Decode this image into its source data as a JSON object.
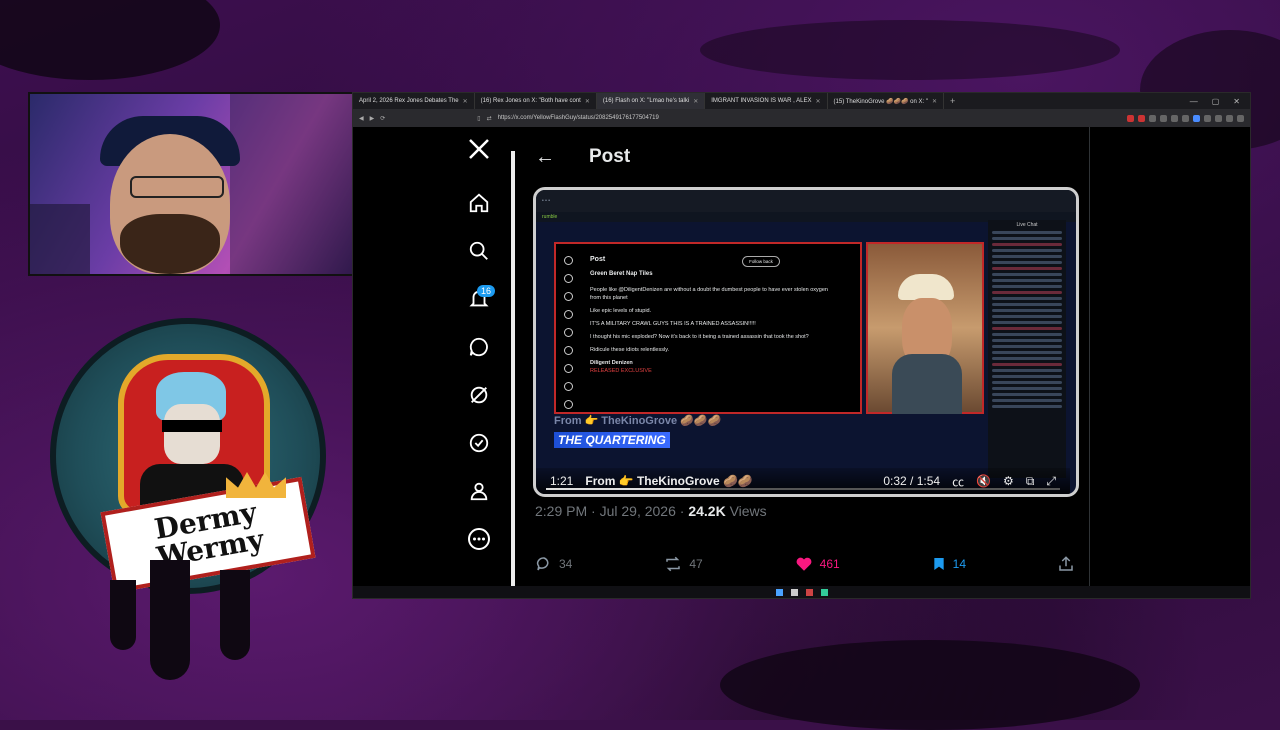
{
  "browser": {
    "tabs": [
      {
        "label": "April 2, 2026 Rex Jones Debates The"
      },
      {
        "label": "(16) Rex Jones on X: \"Both have cont"
      },
      {
        "label": "(16) Flash on X: \"Lmao he's talki",
        "active": true
      },
      {
        "label": "IMGRANT INVASION IS WAR , ALEX"
      },
      {
        "label": "(15) TheKinoGrove 🥔🥔🥔 on X: \""
      }
    ],
    "new_tab": "+",
    "url": "https://x.com/YellowFlashGuy/status/2082549176177504719"
  },
  "x_nav": {
    "notification_count": "16",
    "icons": [
      "x-logo-icon",
      "home-icon",
      "search-icon",
      "bell-icon",
      "message-icon",
      "grok-icon",
      "verified-icon",
      "profile-icon",
      "more-icon"
    ]
  },
  "post": {
    "back_arrow": "←",
    "title": "Post",
    "time": "2:29 PM · Jul 29, 2026",
    "separator": "·",
    "views_count": "24.2K",
    "views_label": "Views",
    "replies": "34",
    "reposts": "47",
    "likes": "461",
    "bookmarks": "14"
  },
  "video": {
    "brand": "rumble",
    "chat_title": "Live Chat",
    "inner_tweet": {
      "page_title": "Post",
      "author": "Green Beret Nap Tiles",
      "follow": "Follow back",
      "lines": [
        "People like @DiligentDenizen are without a doubt the dumbest people to have ever stolen oxygen from this planet",
        "Like epic levels of stupid.",
        "IT'S A MILITARY CRAWL GUYS THIS IS A TRAINED ASSASSIN!!!!!",
        "I thought his mic exploded? Now it's back to it being a trained assassin that took the shot?",
        "Ridicule these idiots relentlessly."
      ],
      "quoted_author": "Diligent Denizen",
      "quoted_label": "RELEASED EXCLUSIVE"
    },
    "from_banner": "From 👉 TheKinoGrove 🥔🥔🥔",
    "quartering": "THE QUARTERING",
    "time_left": "1:21",
    "from_text": "From 👉 TheKinoGrove 🥔🥔",
    "time_right": "0:32 / 1:54",
    "progress": 0.28
  },
  "overlay": {
    "logo_line1": "Dermy",
    "logo_line2": "Wermy"
  },
  "colors": {
    "like": "#f91880",
    "bookmark": "#1d9bf0",
    "badge": "#1d9bf0"
  }
}
